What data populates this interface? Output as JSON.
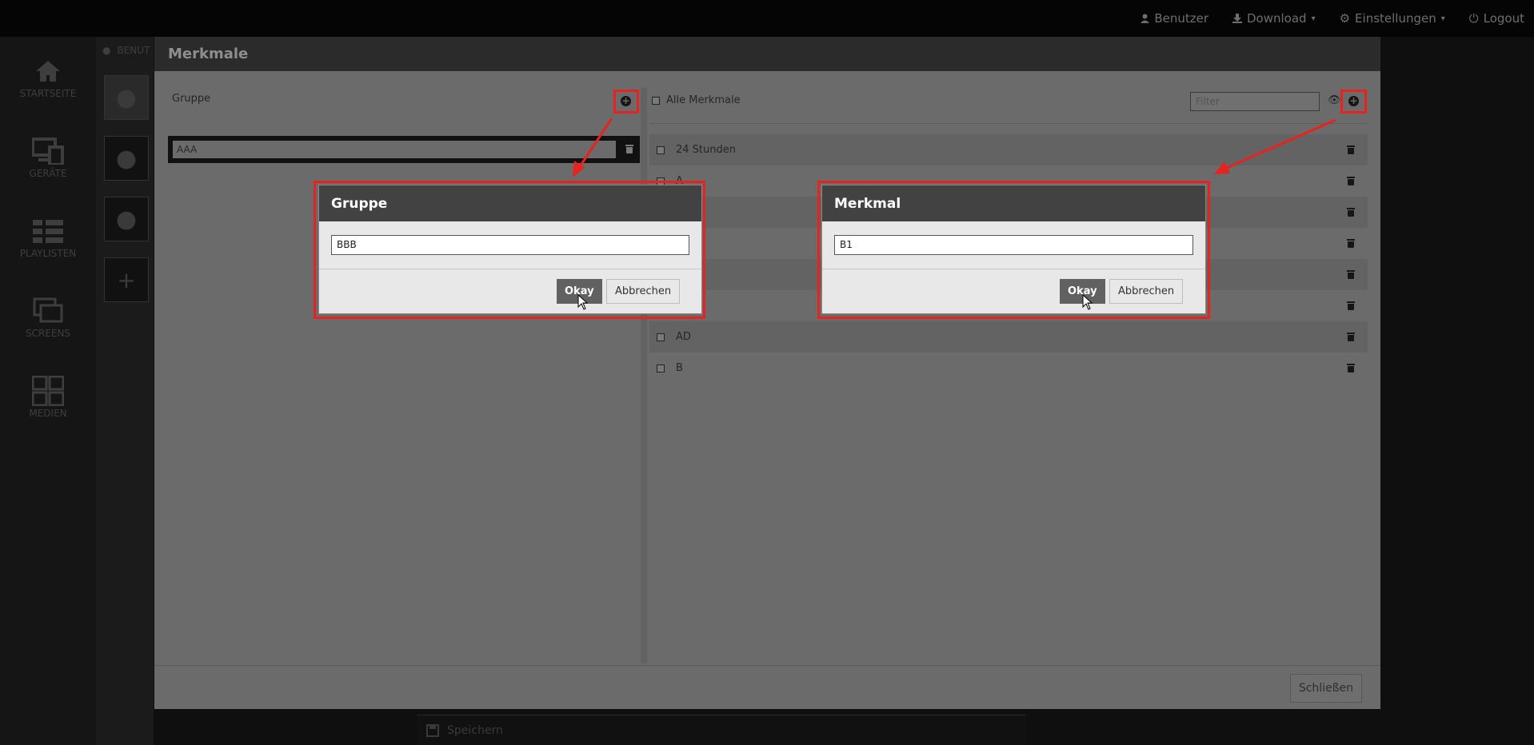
{
  "topnav": {
    "benutzer": "Benutzer",
    "download": "Download",
    "einstellungen": "Einstellungen",
    "logout": "Logout"
  },
  "sidebar": {
    "items": [
      {
        "label": "STARTSEITE",
        "icon": "home-icon"
      },
      {
        "label": "GERÄTE",
        "icon": "devices-icon"
      },
      {
        "label": "PLAYLISTEN",
        "icon": "playlist-icon"
      },
      {
        "label": "SCREENS",
        "icon": "screens-icon"
      },
      {
        "label": "MEDIEN",
        "icon": "media-icon"
      }
    ]
  },
  "users": {
    "header": "BENUT"
  },
  "savebar": {
    "label": "Speichern"
  },
  "modal": {
    "title": "Merkmale",
    "close_label": "Schließen",
    "left": {
      "title": "Gruppe",
      "groups": [
        {
          "name": "AAA"
        }
      ]
    },
    "right": {
      "all_label": "Alle Merkmale",
      "filter_placeholder": "Filter",
      "items": [
        "24 Stunden",
        "A",
        "",
        "",
        "",
        "",
        "AD",
        "B"
      ]
    }
  },
  "dialogs": {
    "group": {
      "title": "Gruppe",
      "value": "BBB",
      "okay": "Okay",
      "cancel": "Abbrechen"
    },
    "feature": {
      "title": "Merkmal",
      "value": "B1",
      "okay": "Okay",
      "cancel": "Abbrechen"
    }
  },
  "colors": {
    "highlight": "#e8231f",
    "dialog_header": "#424242"
  }
}
